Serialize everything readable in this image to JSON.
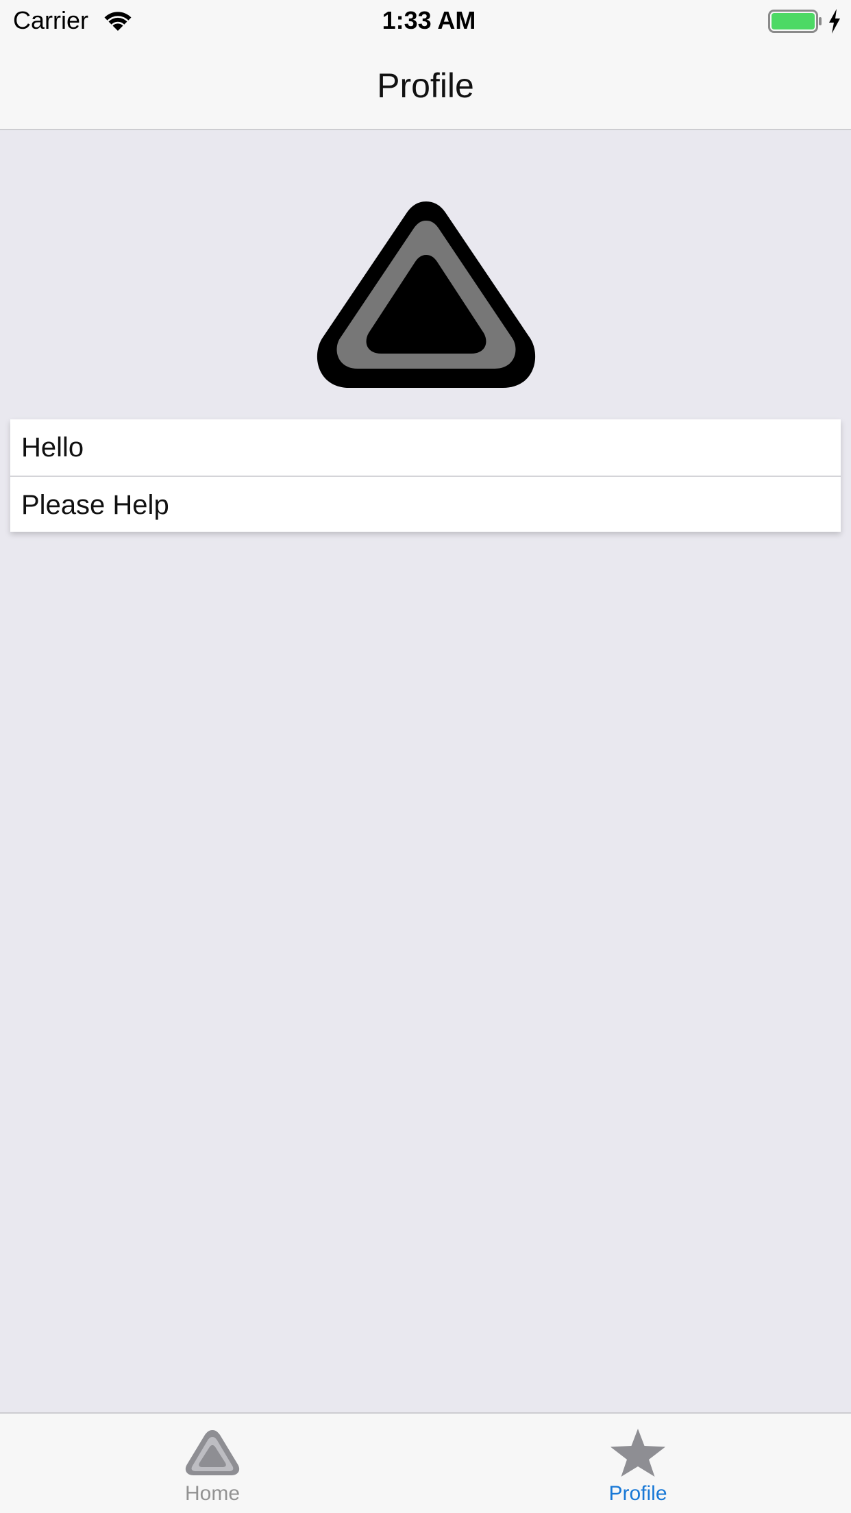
{
  "status_bar": {
    "carrier": "Carrier",
    "time": "1:33 AM",
    "wifi_icon": "wifi-icon",
    "battery_icon": "battery-charging-icon",
    "battery_color": "#4cd964"
  },
  "nav_bar": {
    "title": "Profile"
  },
  "profile": {
    "image_icon": "rounded-triangle-logo"
  },
  "list": {
    "items": [
      {
        "label": "Hello"
      },
      {
        "label": "Please Help"
      }
    ]
  },
  "tab_bar": {
    "tabs": [
      {
        "label": "Home",
        "icon": "triangle-icon",
        "selected": false
      },
      {
        "label": "Profile",
        "icon": "star-icon",
        "selected": true
      }
    ],
    "active_color": "#1878d6",
    "inactive_color": "#929292"
  }
}
